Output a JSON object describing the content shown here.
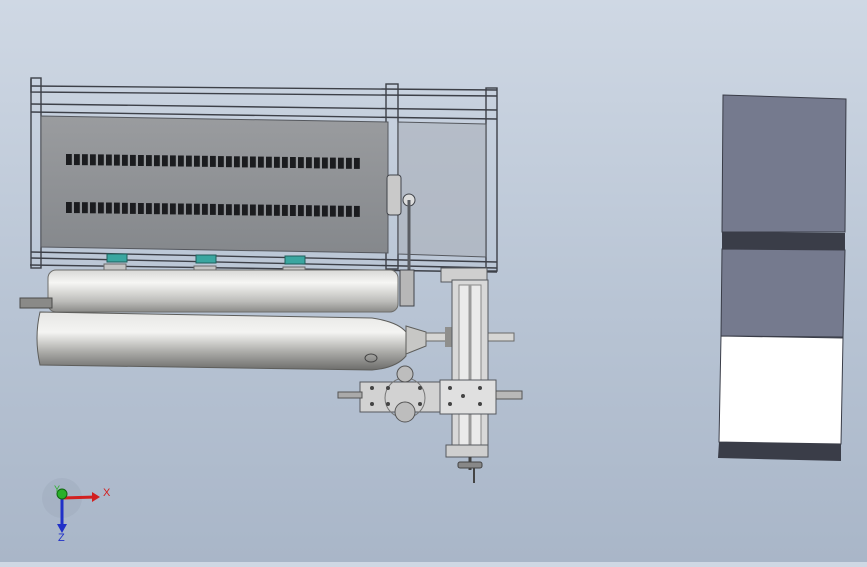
{
  "app": {
    "type": "cad-3d-viewport",
    "background_top": "#cfd8e4",
    "background_bottom": "#a9b6c8"
  },
  "triad": {
    "x_label": "X",
    "y_label": "Y",
    "z_label": "Z",
    "x_color": "#d22020",
    "y_color": "#2ab02a",
    "z_color": "#2030c8"
  },
  "model": {
    "machine": {
      "frame_color": "#4c5059",
      "panel_color": "#8a8d91",
      "slot_color": "#1b1c1f",
      "cylinder_color": "#b5b5b3",
      "bracket_color": "#3aa6a0"
    },
    "side_block": {
      "top_color": "#757a8e",
      "band_color": "#3a3d48",
      "bottom_color": "#ffffff"
    }
  }
}
